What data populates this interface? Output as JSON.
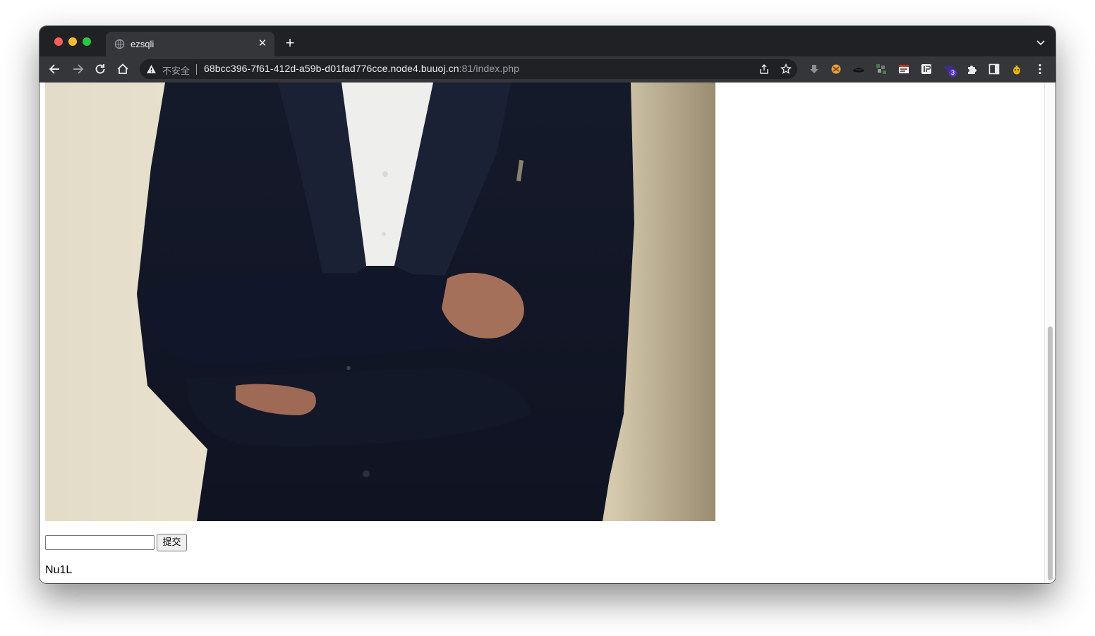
{
  "browser": {
    "tab": {
      "title": "ezsqli",
      "favicon": "globe-icon",
      "close_icon": "close-icon"
    },
    "new_tab_icon": "plus-icon",
    "tab_search_icon": "chevron-down-icon",
    "nav": {
      "back_icon": "arrow-left-icon",
      "forward_icon": "arrow-right-icon",
      "reload_icon": "reload-icon",
      "home_icon": "home-icon"
    },
    "omnibox": {
      "security_label": "不安全",
      "url_host": "68bcc396-7f61-412d-a59b-d01fad776cce.node4.buuoj.cn",
      "url_rest": ":81/index.php",
      "share_icon": "share-icon",
      "bookmark_icon": "star-icon"
    },
    "extensions": [
      {
        "name": "download-arrow-extension-icon"
      },
      {
        "name": "orange-circle-extension-icon"
      },
      {
        "name": "hat-extension-icon"
      },
      {
        "name": "grid-extension-icon"
      },
      {
        "name": "card-extension-icon"
      },
      {
        "name": "ip-extension-icon"
      },
      {
        "name": "purple-extension-icon",
        "badge": "3"
      },
      {
        "name": "puzzle-extension-icon"
      },
      {
        "name": "side-panel-icon"
      },
      {
        "name": "yellow-extension-icon"
      },
      {
        "name": "menu-icon"
      }
    ],
    "colors": {
      "tab_strip": "#202124",
      "toolbar": "#35363a",
      "text": "#e8eaed",
      "muted": "#9aa0a6",
      "badge": "#5b34d6"
    }
  },
  "page": {
    "image_alt": "photo of person in dark suit with arms crossed",
    "form": {
      "input_value": "",
      "submit_label": "提交"
    },
    "result_text": "Nu1L"
  }
}
